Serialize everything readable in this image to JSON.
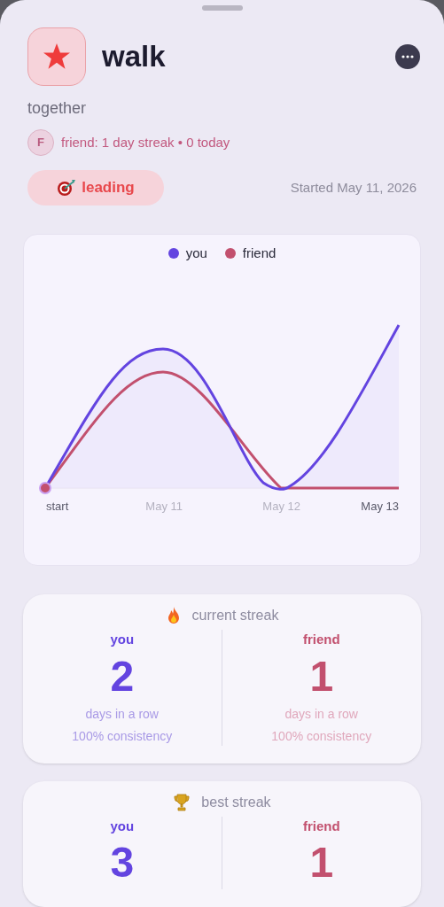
{
  "habit": {
    "title": "walk",
    "subtitle": "together"
  },
  "friend_status": {
    "avatar_letter": "F",
    "text": "friend: 1 day streak • 0 today"
  },
  "status_badge": {
    "label": "leading"
  },
  "started": "Started May 11, 2026",
  "chart": {
    "legend": [
      {
        "label": "you",
        "color": "#6344e0"
      },
      {
        "label": "friend",
        "color": "#c2506e"
      }
    ],
    "x_labels": [
      "start",
      "May 11",
      "May 12",
      "May 13"
    ]
  },
  "streak_cards": [
    {
      "kind": "current",
      "title": "current streak",
      "columns": [
        {
          "name": "you",
          "value": "2",
          "caption": "days in a row",
          "consistency": "100% consistency"
        },
        {
          "name": "friend",
          "value": "1",
          "caption": "days in a row",
          "consistency": "100% consistency"
        }
      ]
    },
    {
      "kind": "best",
      "title": "best streak",
      "columns": [
        {
          "name": "you",
          "value": "3"
        },
        {
          "name": "friend",
          "value": "1"
        }
      ]
    }
  ]
}
